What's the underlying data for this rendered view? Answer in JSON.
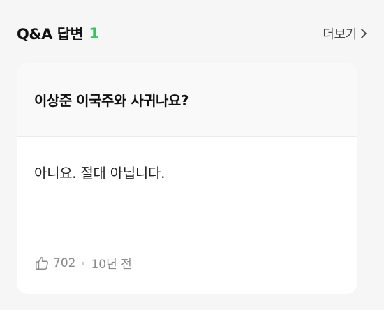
{
  "header": {
    "title": "Q&A 답변",
    "count": "1",
    "more_label": "더보기"
  },
  "card": {
    "question": "이상준 이국주와 사귀나요?",
    "answer": "아니요. 절대 아닙니다.",
    "likes": "702",
    "time_ago": "10년 전"
  },
  "icons": {
    "more": "chevron-right-icon",
    "like": "thumbs-up-icon"
  },
  "colors": {
    "accent_count": "#3ec05f",
    "background": "#f6f6f6",
    "card": "#ffffff"
  }
}
